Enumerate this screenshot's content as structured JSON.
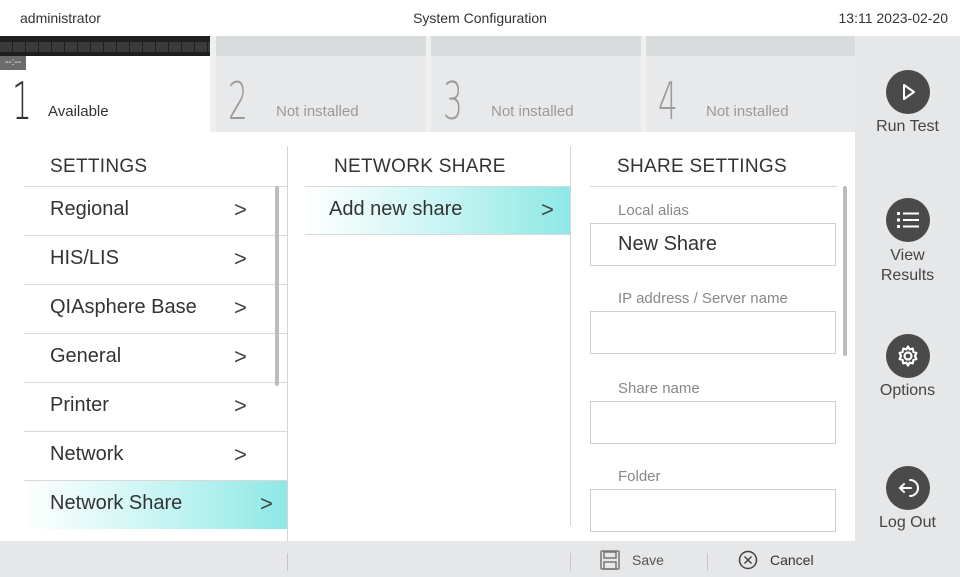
{
  "topbar": {
    "user": "administrator",
    "title": "System Configuration",
    "clock": "13:11 2023-02-20"
  },
  "modules": [
    {
      "number": "1",
      "label": "Available",
      "tag": "--:--"
    },
    {
      "number": "2",
      "label": "Not installed"
    },
    {
      "number": "3",
      "label": "Not installed"
    },
    {
      "number": "4",
      "label": "Not installed"
    }
  ],
  "nav": {
    "run_test": "Run Test",
    "view_results_1": "View",
    "view_results_2": "Results",
    "options": "Options",
    "log_out": "Log Out"
  },
  "settings": {
    "header": "SETTINGS",
    "items": [
      {
        "label": "Regional"
      },
      {
        "label": "HIS/LIS"
      },
      {
        "label": "QIAsphere Base"
      },
      {
        "label": "General"
      },
      {
        "label": "Printer"
      },
      {
        "label": "Network"
      },
      {
        "label": "Network Share"
      }
    ],
    "chevron": ">"
  },
  "network_share": {
    "header": "NETWORK SHARE",
    "add_label": "Add new share",
    "chevron": ">"
  },
  "share_settings": {
    "header": "SHARE SETTINGS",
    "local_alias_label": "Local alias",
    "local_alias_value": "New Share",
    "ip_label": "IP address / Server name",
    "ip_value": "",
    "share_name_label": "Share name",
    "share_name_value": "",
    "folder_label": "Folder",
    "folder_value": ""
  },
  "bottombar": {
    "save": "Save",
    "cancel": "Cancel"
  },
  "colors": {
    "accent": "#8ee8e6",
    "nav_circle": "#4a4a4a"
  }
}
